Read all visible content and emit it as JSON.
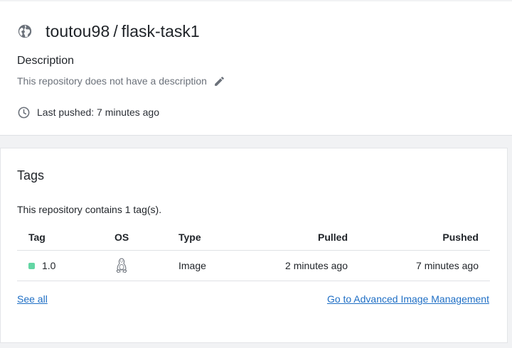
{
  "repo": {
    "owner": "toutou98",
    "separator": "/",
    "name": "flask-task1",
    "visibility_icon": "globe-icon"
  },
  "description": {
    "heading": "Description",
    "text": "This repository does not have a description",
    "edit_icon": "pencil-icon"
  },
  "last_pushed": {
    "icon": "clock-icon",
    "text": "Last pushed: 7 minutes ago"
  },
  "tags": {
    "heading": "Tags",
    "summary": "This repository contains 1 tag(s).",
    "columns": {
      "tag": "Tag",
      "os": "OS",
      "type": "Type",
      "pulled": "Pulled",
      "pushed": "Pushed"
    },
    "rows": [
      {
        "tag": "1.0",
        "status_color": "#63d6a4",
        "os_icon": "linux-icon",
        "type": "Image",
        "pulled": "2 minutes ago",
        "pushed": "7 minutes ago"
      }
    ],
    "see_all": "See all",
    "advanced_link": "Go to Advanced Image Management"
  },
  "colors": {
    "link": "#1f6fc5",
    "muted_text": "#6b717a",
    "status_active": "#63d6a4",
    "background": "#f1f2f4"
  }
}
